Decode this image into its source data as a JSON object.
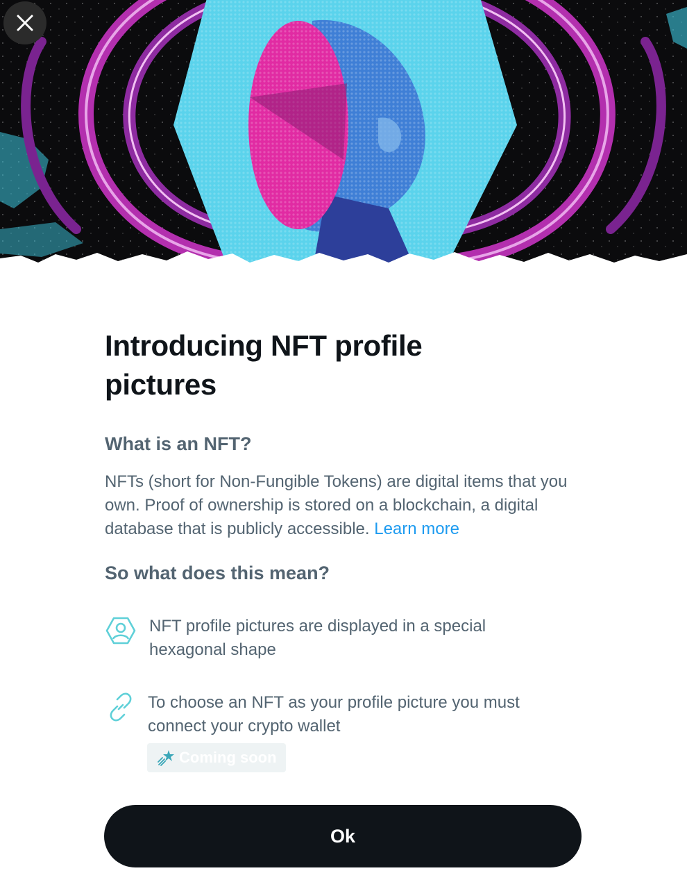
{
  "dialog": {
    "title": "Introducing NFT profile pictures",
    "close_icon": "close-icon",
    "hero_illustration": "nft-head-illustration"
  },
  "section_nft": {
    "heading": "What is an NFT?",
    "body": "NFTs (short for Non-Fungible Tokens) are digital items that you own. Proof of ownership is stored on a blockchain, a digital database that is publicly accessible.",
    "link_label": "Learn more"
  },
  "section_meaning": {
    "heading": "So what does this mean?",
    "items": [
      {
        "icon": "hexagon-profile-icon",
        "text": "NFT profile pictures are displayed in a special hexagonal shape"
      },
      {
        "icon": "link-icon",
        "text": "To choose an NFT as your profile picture you must connect your crypto wallet",
        "badge": {
          "icon": "shooting-star-icon",
          "label": "Coming soon"
        }
      }
    ]
  },
  "actions": {
    "ok_label": "Ok"
  },
  "colors": {
    "primary_text": "#0f1419",
    "secondary_text": "#536471",
    "link": "#1d9bf0",
    "icon_accent": "#5fd0d8",
    "button_bg": "#0f1419"
  }
}
